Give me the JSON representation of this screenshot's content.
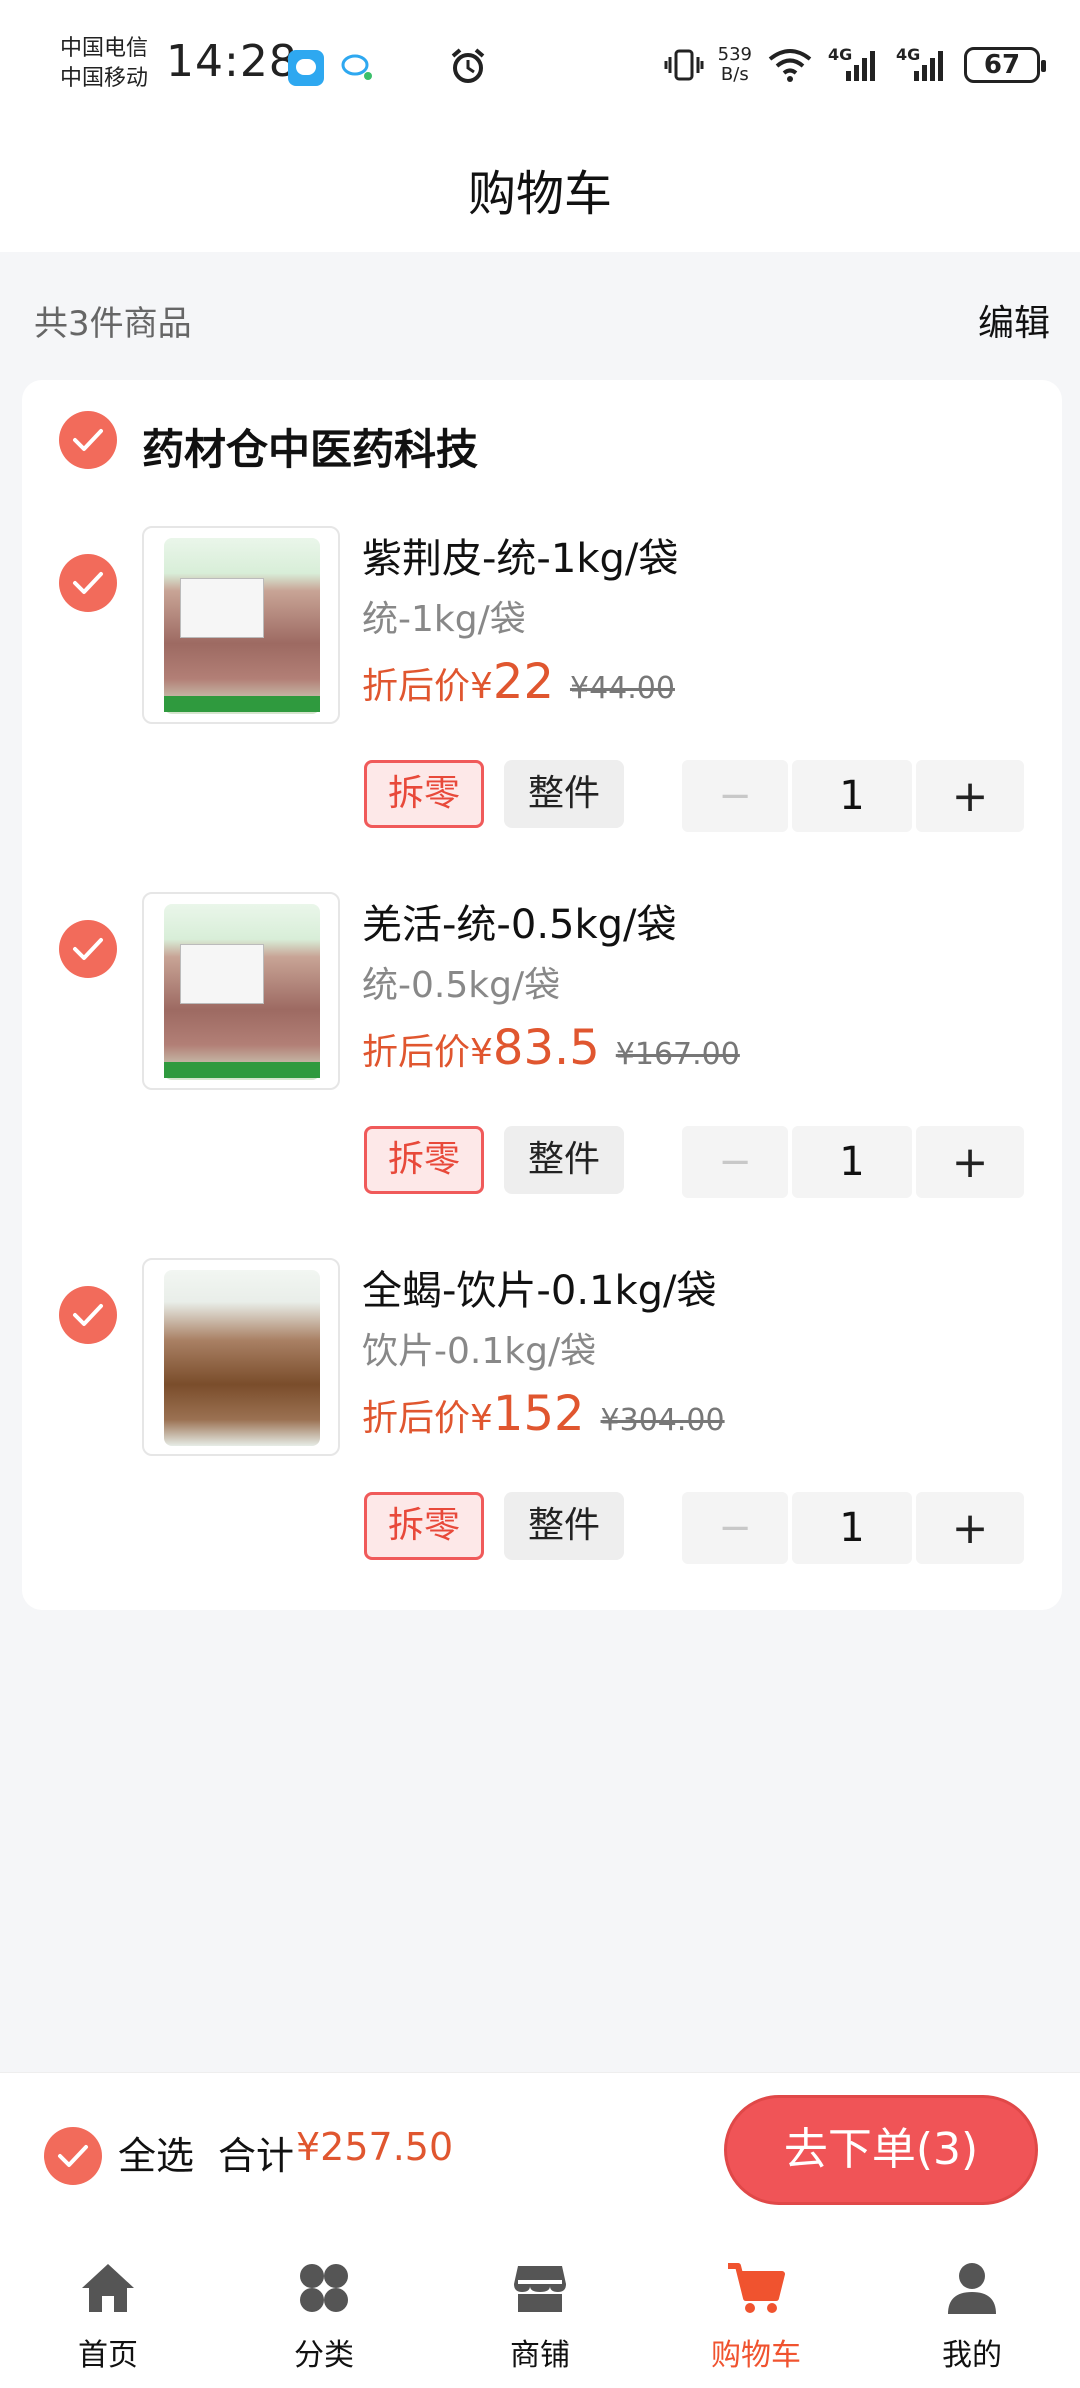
{
  "status_bar": {
    "carrier_1": "中国电信",
    "carrier_2": "中国移动",
    "time": "14:28",
    "net_speed_value": "539",
    "net_speed_unit": "B/s",
    "signal_1": "4G",
    "signal_2": "4G",
    "battery": "67"
  },
  "header": {
    "title": "购物车"
  },
  "summary": {
    "count_text": "共3件商品",
    "edit_label": "编辑"
  },
  "store": {
    "name": "药材仓中医药科技",
    "items": [
      {
        "name": "紫荆皮-统-1kg/袋",
        "spec": "统-1kg/袋",
        "price_label": "折后价¥",
        "price": "22",
        "original_price": "¥44.00",
        "split_label": "拆零",
        "whole_label": "整件",
        "quantity": "1",
        "image": "herb-bag-package-image"
      },
      {
        "name": "羌活-统-0.5kg/袋",
        "spec": "统-0.5kg/袋",
        "price_label": "折后价¥",
        "price": "83.5",
        "original_price": "¥167.00",
        "split_label": "拆零",
        "whole_label": "整件",
        "quantity": "1",
        "image": "herb-bag-package-image"
      },
      {
        "name": "全蝎-饮片-0.1kg/袋",
        "spec": "饮片-0.1kg/袋",
        "price_label": "折后价¥",
        "price": "152",
        "original_price": "¥304.00",
        "split_label": "拆零",
        "whole_label": "整件",
        "quantity": "1",
        "image": "herb-bag-package-image"
      }
    ]
  },
  "checkout": {
    "select_all_label": "全选",
    "total_label": "合计",
    "total_value": "¥257.50",
    "order_button": "去下单(3)"
  },
  "tabs": [
    {
      "label": "首页",
      "icon": "home-icon"
    },
    {
      "label": "分类",
      "icon": "category-icon"
    },
    {
      "label": "商铺",
      "icon": "store-icon"
    },
    {
      "label": "购物车",
      "icon": "cart-icon",
      "active": true
    },
    {
      "label": "我的",
      "icon": "user-icon"
    }
  ],
  "colors": {
    "accent": "#f0532f",
    "check": "#f26b5b",
    "price": "#e0562f",
    "order_button": "#f05457"
  }
}
